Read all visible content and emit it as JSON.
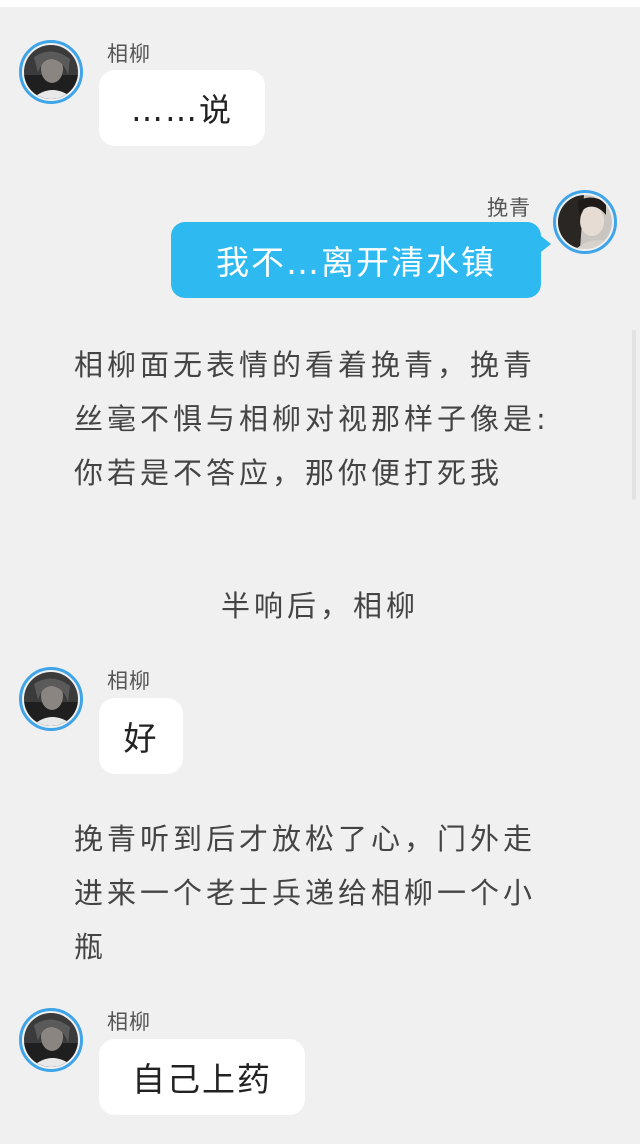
{
  "messages": [
    {
      "speaker": "相柳",
      "text": "……说"
    },
    {
      "speaker": "挽青",
      "text": "我不…离开清水镇"
    },
    {
      "speaker": "相柳",
      "text": "好"
    },
    {
      "speaker": "相柳",
      "text": "自己上药"
    }
  ],
  "narrations": [
    "相柳面无表情的看着挽青，挽青丝毫不惧与相柳对视那样子像是:你若是不答应，那你便打死我",
    "半响后，相柳",
    "挽青听到后才放松了心，门外走进来一个老士兵递给相柳一个小瓶"
  ],
  "colors": {
    "background": "#f0f0f0",
    "avatar_ring": "#3fa5e8",
    "blue_bubble": "#2ebaf0",
    "white_bubble": "#ffffff"
  }
}
